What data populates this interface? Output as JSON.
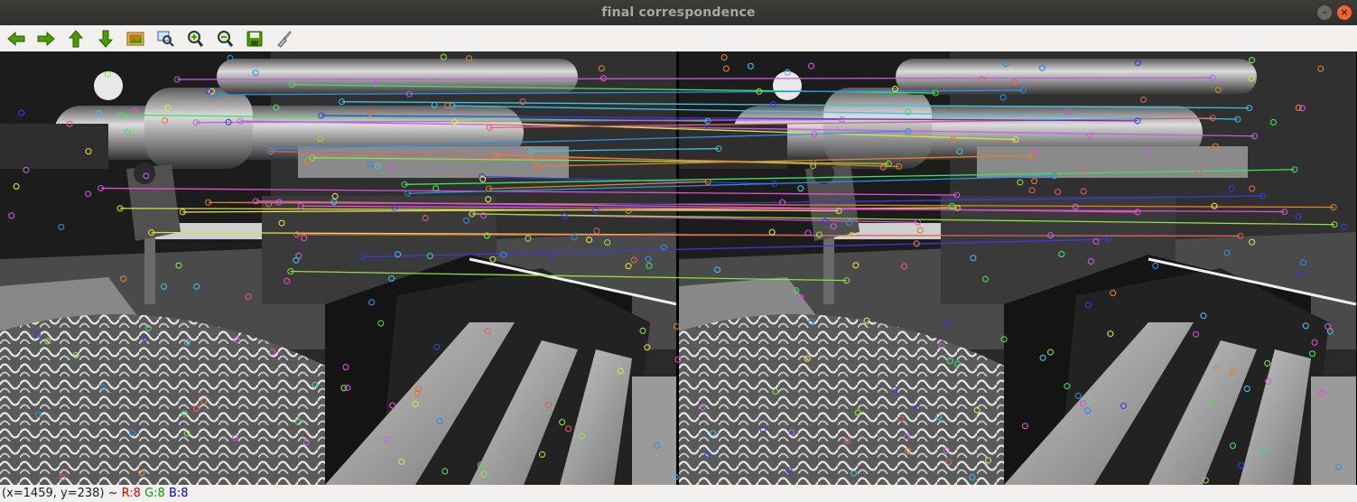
{
  "window": {
    "title": "final correspondence"
  },
  "toolbar": {
    "buttons": [
      {
        "icon": "arrow-left-icon",
        "color": "#4e9a06"
      },
      {
        "icon": "arrow-right-icon",
        "color": "#4e9a06"
      },
      {
        "icon": "arrow-up-icon",
        "color": "#4e9a06"
      },
      {
        "icon": "arrow-down-icon",
        "color": "#4e9a06"
      },
      {
        "icon": "image-icon",
        "color": "#c17d11"
      },
      {
        "icon": "zoom-fit-icon",
        "color": "#3465a4"
      },
      {
        "icon": "zoom-in-icon",
        "color": "#4e9a06"
      },
      {
        "icon": "zoom-out-icon",
        "color": "#4e9a06"
      },
      {
        "icon": "save-icon",
        "color": "#4e9a06"
      },
      {
        "icon": "brush-icon",
        "color": "#888a85"
      }
    ]
  },
  "status": {
    "coords": "(x=1459, y=238) ~",
    "r": "R:8",
    "g": "G:8",
    "b": "B:8"
  },
  "colors": {
    "titlebar": "#3a3935",
    "toolbar_bg": "#f2f1f0",
    "line_palette": [
      "#e0802e",
      "#3a3ae0",
      "#e050d0",
      "#e0e040",
      "#40c0e0",
      "#40e060",
      "#c060e0",
      "#e06060",
      "#2e8ee0",
      "#90e040"
    ]
  }
}
